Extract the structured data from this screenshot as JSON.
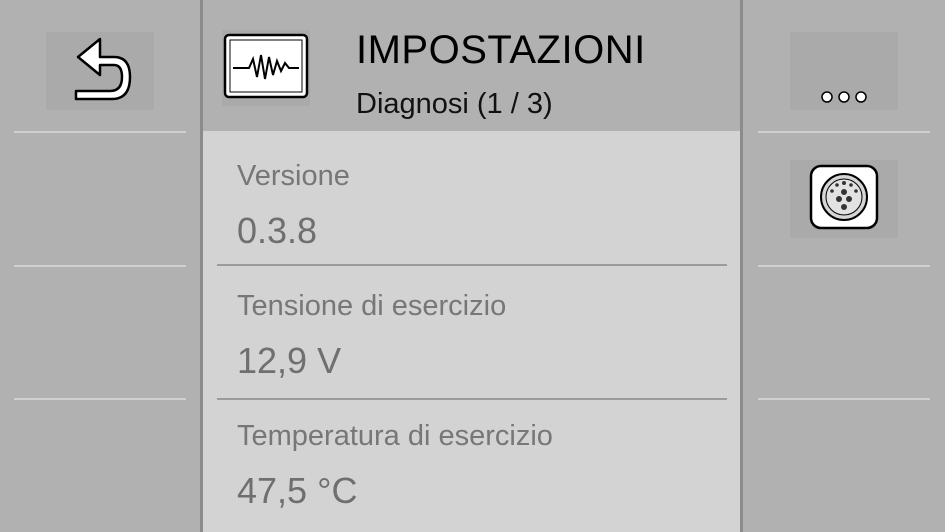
{
  "header": {
    "title": "IMPOSTAZIONI",
    "subtitle": "Diagnosi (1 / 3)",
    "icon": "heartbeat-monitor-icon"
  },
  "left_panel": {
    "back_icon": "back-arrow-icon"
  },
  "right_panel": {
    "more_icon": "more-dots-icon",
    "connector_icon": "connector-plug-icon"
  },
  "rows": [
    {
      "label": "Versione",
      "value": "0.3.8"
    },
    {
      "label": "Tensione di esercizio",
      "value": "12,9 V"
    },
    {
      "label": "Temperatura di esercizio",
      "value": "47,5 °C"
    }
  ],
  "colors": {
    "side_background": "#b1b1b1",
    "content_background": "#d3d3d3",
    "button_background": "#aaaaaa"
  }
}
